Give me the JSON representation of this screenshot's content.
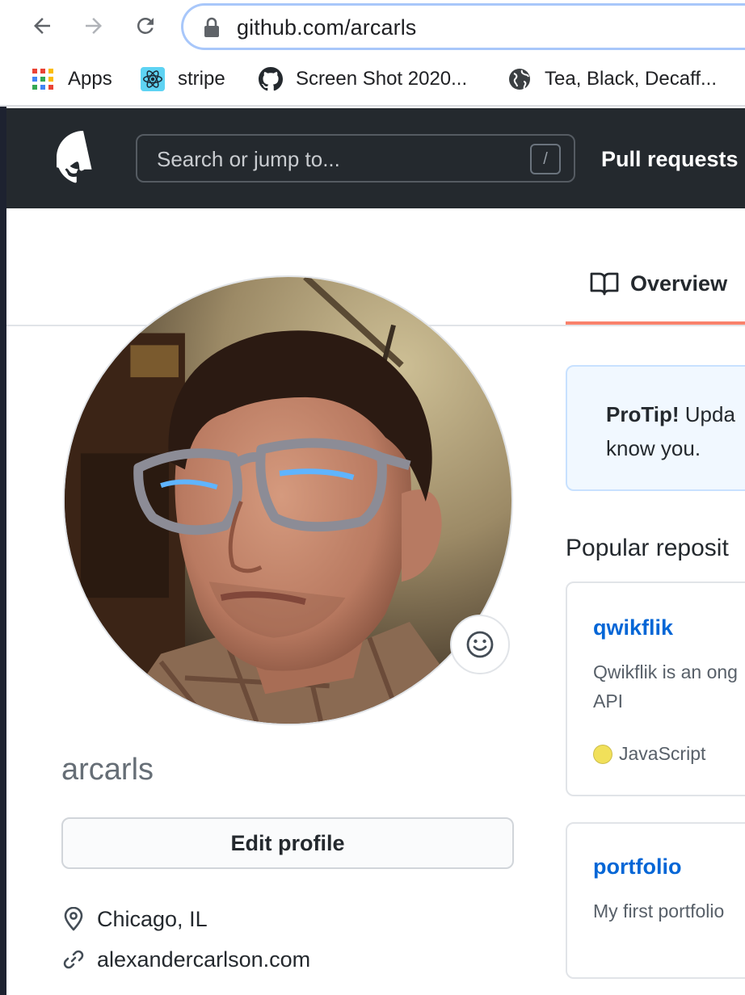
{
  "browser": {
    "url": "github.com/arcarls",
    "bookmarks": [
      {
        "label": "Apps",
        "icon": "apps-grid-icon"
      },
      {
        "label": "stripe",
        "icon": "react-atom-icon"
      },
      {
        "label": "Screen Shot 2020...",
        "icon": "github-octocat-icon"
      },
      {
        "label": "Tea, Black, Decaff...",
        "icon": "globe-icon"
      }
    ]
  },
  "header": {
    "search_placeholder": "Search or jump to...",
    "search_shortcut": "/",
    "nav_pull_requests": "Pull requests"
  },
  "tabs": {
    "overview": "Overview"
  },
  "profile": {
    "username": "arcarls",
    "edit_label": "Edit profile",
    "location": "Chicago, IL",
    "website": "alexandercarlson.com"
  },
  "protip": {
    "bold": "ProTip!",
    "line1": " Upda",
    "line2": "know you."
  },
  "popular": {
    "heading": "Popular reposit",
    "repos": [
      {
        "name": "qwikflik",
        "desc_line1": "Qwikflik is an ong",
        "desc_line2": "API",
        "language": "JavaScript",
        "language_color": "#f1e05a"
      },
      {
        "name": "portfolio",
        "desc_line1": "My first portfolio"
      }
    ]
  },
  "colors": {
    "header_bg": "#24292e",
    "link_blue": "#0366d6",
    "tab_accent": "#f9826c",
    "protip_bg": "#f1f8ff"
  }
}
